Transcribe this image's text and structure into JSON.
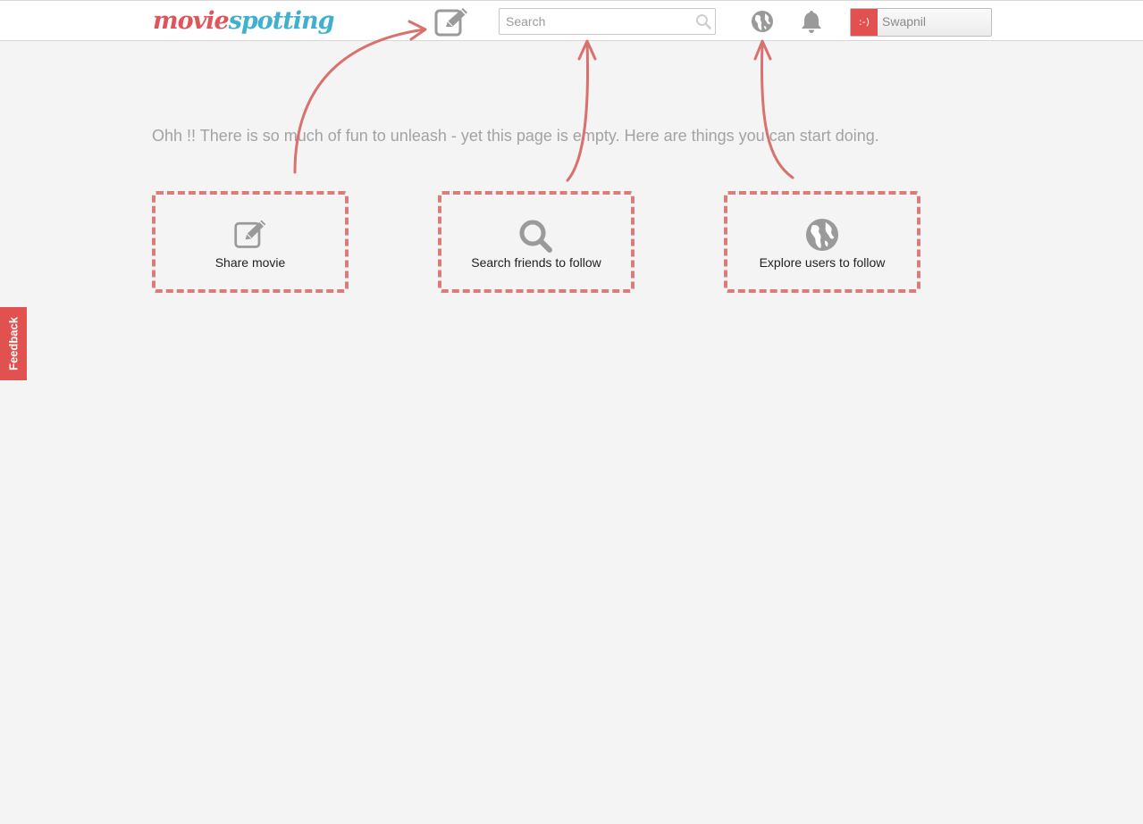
{
  "header": {
    "logo_part1": "movie",
    "logo_part2": "spotting",
    "search_placeholder": "Search",
    "user": {
      "avatar_text": ":-)",
      "name": "Swapnil"
    },
    "icons": {
      "compose": "pencil-square-icon",
      "search": "search-icon",
      "explore": "globe-icon",
      "notifications": "bell-icon"
    }
  },
  "main": {
    "empty_message": "Ohh !! There is so much of fun to unleash - yet this page is empty. Here are things you can start doing.",
    "cards": [
      {
        "label": "Share movie",
        "icon": "pencil-square-icon"
      },
      {
        "label": "Search friends to follow",
        "icon": "search-icon"
      },
      {
        "label": "Explore users to follow",
        "icon": "globe-icon"
      }
    ]
  },
  "feedback": {
    "label": "Feedback"
  },
  "colors": {
    "accent_red": "#e0514f",
    "dashed_border": "#da7c78",
    "logo_red": "#e0555b",
    "logo_blue": "#3fb0cf",
    "icon_gray": "#9a9a9a",
    "background": "#f4f4f4"
  }
}
